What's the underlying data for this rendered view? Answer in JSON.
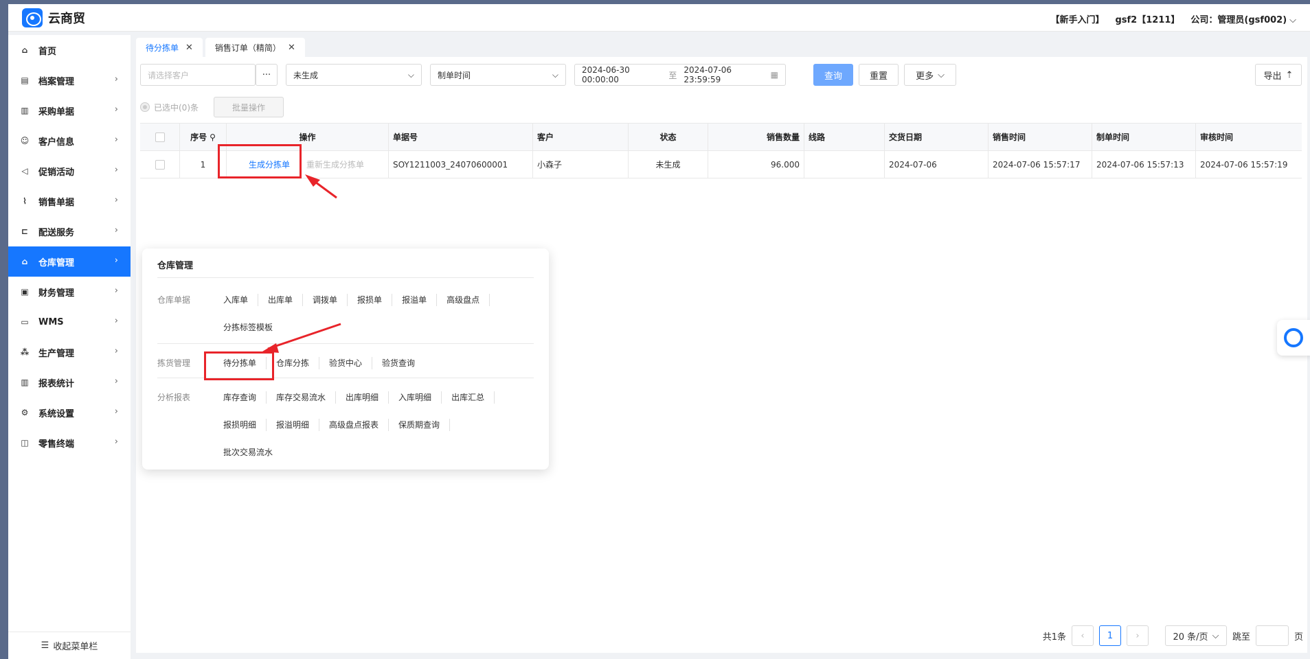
{
  "app": {
    "title": "云商贸"
  },
  "topbar": {
    "guide": "【新手入门】",
    "user": "gsf2【1211】",
    "company": "公司：管理员(gsf002)"
  },
  "sidebar": {
    "items": [
      {
        "label": "首页",
        "icon": "home-icon"
      },
      {
        "label": "档案管理",
        "icon": "archive-icon"
      },
      {
        "label": "采购单据",
        "icon": "purchase-icon"
      },
      {
        "label": "客户信息",
        "icon": "user-icon"
      },
      {
        "label": "促销活动",
        "icon": "megaphone-icon"
      },
      {
        "label": "销售单据",
        "icon": "chart-icon"
      },
      {
        "label": "配送服务",
        "icon": "cart-icon"
      },
      {
        "label": "仓库管理",
        "icon": "warehouse-icon"
      },
      {
        "label": "财务管理",
        "icon": "finance-icon"
      },
      {
        "label": "WMS",
        "icon": "truck-icon"
      },
      {
        "label": "生产管理",
        "icon": "production-icon"
      },
      {
        "label": "报表统计",
        "icon": "report-icon"
      },
      {
        "label": "系统设置",
        "icon": "settings-icon"
      },
      {
        "label": "零售终端",
        "icon": "bag-icon"
      }
    ],
    "active_index": 7,
    "collapse_label": "收起菜单栏"
  },
  "tabs": [
    {
      "label": "待分拣单",
      "active": true
    },
    {
      "label": "销售订单（精简）",
      "active": false
    }
  ],
  "filters": {
    "customer_placeholder": "请选择客户",
    "more_dots": "···",
    "status_value": "未生成",
    "time_type": "制单时间",
    "date_start": "2024-06-30 00:00:00",
    "date_sep": "至",
    "date_end": "2024-07-06 23:59:59",
    "query": "查询",
    "reset": "重置",
    "more": "更多",
    "export": "导出"
  },
  "selection": {
    "selected_text": "已选中(0)条",
    "batch": "批量操作"
  },
  "table": {
    "headers": [
      "序号",
      "操作",
      "单据号",
      "客户",
      "状态",
      "销售数量",
      "线路",
      "交货日期",
      "销售时间",
      "制单时间",
      "审核时间"
    ],
    "rows": [
      {
        "index": "1",
        "action_primary": "生成分拣单",
        "action_secondary": "重新生成分拣单",
        "order_no": "SOY1211003_24070600001",
        "customer": "小森子",
        "status": "未生成",
        "quantity": "96.000",
        "route": "",
        "delivery_date": "2024-07-06",
        "sale_time": "2024-07-06 15:57:17",
        "create_time": "2024-07-06 15:57:13",
        "audit_time": "2024-07-06 15:57:19"
      }
    ]
  },
  "popup": {
    "title": "仓库管理",
    "groups": [
      {
        "label": "仓库单据",
        "items": [
          "入库单",
          "出库单",
          "调拨单",
          "报损单",
          "报溢单",
          "高级盘点",
          "分拣标签模板"
        ]
      },
      {
        "label": "拣货管理",
        "items": [
          "待分拣单",
          "仓库分拣",
          "验货中心",
          "验货查询"
        ]
      },
      {
        "label": "分析报表",
        "items": [
          "库存查询",
          "库存交易流水",
          "出库明细",
          "入库明细",
          "出库汇总",
          "报损明细",
          "报溢明细",
          "高级盘点报表",
          "保质期查询",
          "批次交易流水"
        ]
      }
    ]
  },
  "pager": {
    "total": "共1条",
    "current": "1",
    "page_size": "20 条/页",
    "jump": "跳至",
    "page_unit": "页"
  },
  "colors": {
    "primary": "#1677ff",
    "annotation": "#e8242a"
  }
}
